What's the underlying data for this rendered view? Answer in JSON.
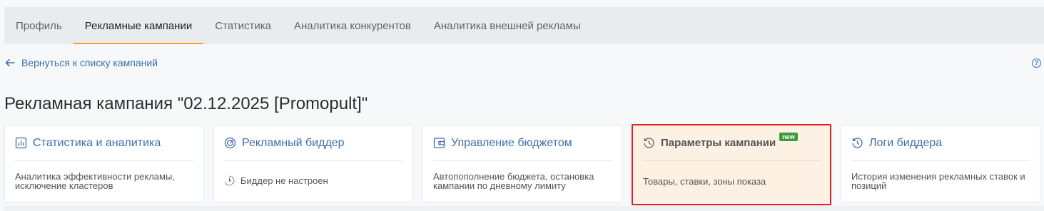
{
  "tabs": [
    {
      "label": "Профиль",
      "active": false
    },
    {
      "label": "Рекламные кампании",
      "active": true
    },
    {
      "label": "Статистика",
      "active": false
    },
    {
      "label": "Аналитика конкурентов",
      "active": false
    },
    {
      "label": "Аналитика внешней рекламы",
      "active": false
    }
  ],
  "back_link": "Вернуться к списку кампаний",
  "help_icon": "question-circle-icon",
  "page_title": "Рекламная кампания \"02.12.2025 [Promopult]\"",
  "cards": [
    {
      "title": "Статистика и аналитика",
      "icon": "chart-icon",
      "description": "Аналитика эффективности рекламы, исключение кластеров"
    },
    {
      "title": "Рекламный биддер",
      "icon": "bidder-icon",
      "description": "Биддер не настроен",
      "description_icon": "clock-warning-icon"
    },
    {
      "title": "Управление бюджетом",
      "icon": "wallet-icon",
      "description": "Автопополнение бюджета, остановка кампании по дневному лимиту"
    },
    {
      "title": "Параметры кампании",
      "icon": "history-icon",
      "badge": "new",
      "description": "Товары, ставки, зоны показа",
      "selected": true
    },
    {
      "title": "Логи биддера",
      "icon": "history-icon",
      "description": "История изменения рекламных ставок и позиций"
    }
  ],
  "colors": {
    "link": "#3f6fa7",
    "active_tab_underline": "#f2a02a",
    "selection_border": "#e01e26",
    "badge": "#3e9a3a"
  }
}
